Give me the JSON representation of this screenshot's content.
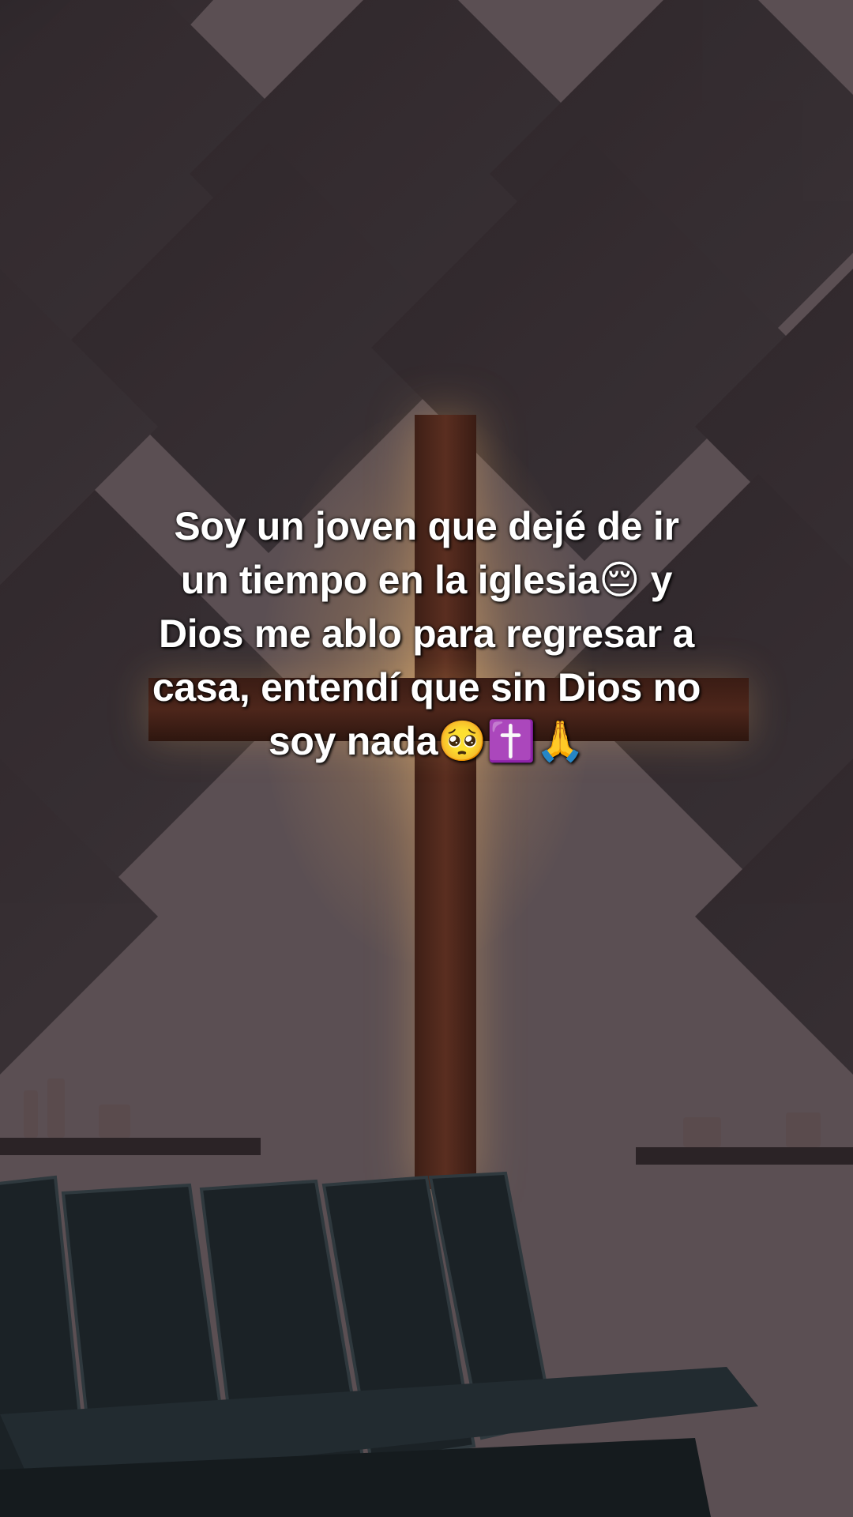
{
  "caption": {
    "lines": [
      "Soy un joven que dejé  de ir",
      "un tiempo en la iglesia😔 y",
      "Dios me ablo para regresar a",
      "casa, entendí que sin Dios no",
      "soy nada🥺✝️🙏"
    ]
  },
  "colors": {
    "wall": "#4a4044",
    "cross": "#4d261b",
    "glow": "#ffc878",
    "chairs": "#1c2327",
    "caption_text": "#ffffff"
  }
}
